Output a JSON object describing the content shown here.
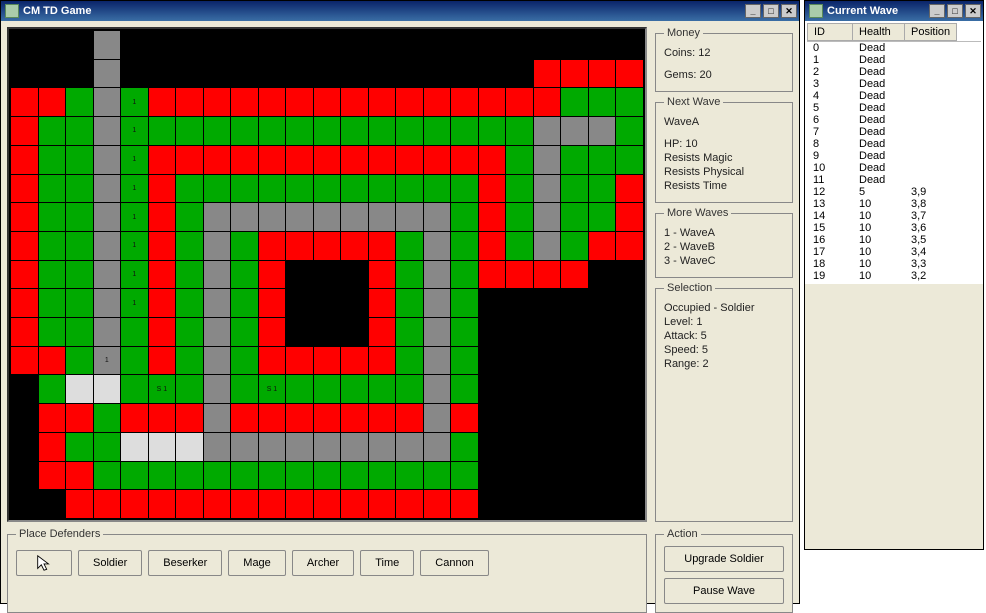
{
  "main": {
    "title": "CM TD Game",
    "money": {
      "legend": "Money",
      "coins_label": "Coins: 12",
      "gems_label": "Gems: 20"
    },
    "next": {
      "legend": "Next Wave",
      "name": "WaveA",
      "hp": "HP: 10",
      "r1": "Resists Magic",
      "r2": "Resists Physical",
      "r3": "Resists Time"
    },
    "more": {
      "legend": "More Waves",
      "w1": "1 - WaveA",
      "w2": "2 - WaveB",
      "w3": "3 - WaveC"
    },
    "sel": {
      "legend": "Selection",
      "l1": "Occupied - Soldier",
      "l2": "Level: 1",
      "l3": "Attack: 5",
      "l4": "Speed: 5",
      "l5": "Range: 2"
    },
    "action": {
      "legend": "Action",
      "upgrade": "Upgrade Soldier",
      "pause": "Pause Wave"
    },
    "defenders": {
      "legend": "Place Defenders",
      "btns": [
        "Soldier",
        "Beserker",
        "Mage",
        "Archer",
        "Time",
        "Cannon"
      ]
    }
  },
  "wave": {
    "title": "Current Wave",
    "cols": {
      "id": "ID",
      "health": "Health",
      "pos": "Position"
    },
    "rows": [
      {
        "id": "0",
        "h": "Dead",
        "p": ""
      },
      {
        "id": "1",
        "h": "Dead",
        "p": ""
      },
      {
        "id": "2",
        "h": "Dead",
        "p": ""
      },
      {
        "id": "3",
        "h": "Dead",
        "p": ""
      },
      {
        "id": "4",
        "h": "Dead",
        "p": ""
      },
      {
        "id": "5",
        "h": "Dead",
        "p": ""
      },
      {
        "id": "6",
        "h": "Dead",
        "p": ""
      },
      {
        "id": "7",
        "h": "Dead",
        "p": ""
      },
      {
        "id": "8",
        "h": "Dead",
        "p": ""
      },
      {
        "id": "9",
        "h": "Dead",
        "p": ""
      },
      {
        "id": "10",
        "h": "Dead",
        "p": ""
      },
      {
        "id": "11",
        "h": "Dead",
        "p": ""
      },
      {
        "id": "12",
        "h": "5",
        "p": "3,9"
      },
      {
        "id": "13",
        "h": "10",
        "p": "3,8"
      },
      {
        "id": "14",
        "h": "10",
        "p": "3,7"
      },
      {
        "id": "15",
        "h": "10",
        "p": "3,6"
      },
      {
        "id": "16",
        "h": "10",
        "p": "3,5"
      },
      {
        "id": "17",
        "h": "10",
        "p": "3,4"
      },
      {
        "id": "18",
        "h": "10",
        "p": "3,3"
      },
      {
        "id": "19",
        "h": "10",
        "p": "3,2"
      }
    ]
  },
  "grid": {
    "cols": 23,
    "rows": 17,
    "map": [
      "bbbpbbbbbbbbbbbbbbbbbbb",
      "bbbpbbbbbbbbbbbbbbbrrrr",
      "rrgpgrrrrrrrrrrrrrrrggg",
      "rggpgggggggggggggggpppg",
      "rggpgrrrrrrrrrrrrrgpggg",
      "rggpgrgggggggggggrgpggr",
      "rggpgrgpppppppppgrgpggr",
      "rggpgrgpgrrrrrgpgrgpgrr",
      "rggpgrgpgrbbbrgpgrrrrbb",
      "rggpgrgpgrbbbrgpgbbbbbb",
      "rggpgrgpgrbbbrgpgbbbbbb",
      "rrgpgrgpgrrrrrgpgbbbbbb",
      "bgwwgggpgggggggpgbbbbbb",
      "brrgrrrprrrrrrrprbbbbbb",
      "brggwwwpppppppppgbbbbbb",
      "brrggggggggggggggbbbbbb",
      "bbrrrrrrrrrrrrrrrbbbbbb"
    ],
    "labels": [
      {
        "r": 2,
        "c": 4,
        "t": "1"
      },
      {
        "r": 3,
        "c": 4,
        "t": "1"
      },
      {
        "r": 4,
        "c": 4,
        "t": "1"
      },
      {
        "r": 5,
        "c": 4,
        "t": "1"
      },
      {
        "r": 6,
        "c": 4,
        "t": "1"
      },
      {
        "r": 7,
        "c": 4,
        "t": "1"
      },
      {
        "r": 8,
        "c": 4,
        "t": "1"
      },
      {
        "r": 9,
        "c": 4,
        "t": "1"
      },
      {
        "r": 11,
        "c": 3,
        "t": "1"
      },
      {
        "r": 12,
        "c": 5,
        "t": "S 1"
      },
      {
        "r": 12,
        "c": 9,
        "t": "S 1"
      }
    ]
  }
}
